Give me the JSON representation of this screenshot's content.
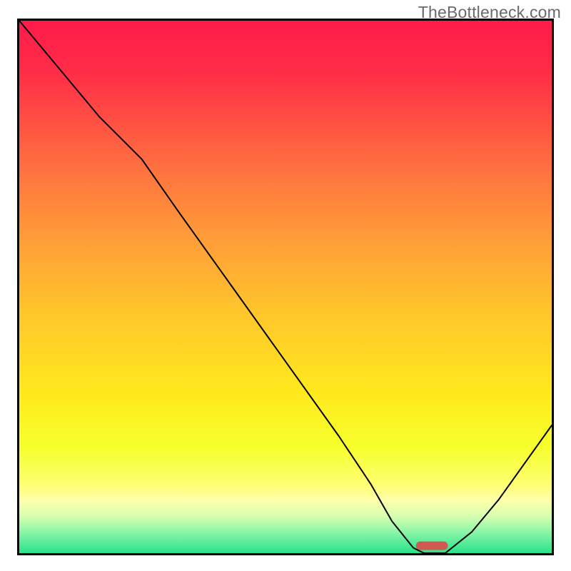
{
  "watermark": "TheBottleneck.com",
  "chart_data": {
    "type": "line",
    "title": "",
    "xlabel": "",
    "ylabel": "",
    "xlim": [
      0,
      100
    ],
    "ylim": [
      0,
      100
    ],
    "x": [
      0,
      5,
      10,
      15,
      20,
      23,
      30,
      40,
      50,
      60,
      66,
      70,
      74,
      76,
      80,
      85,
      90,
      95,
      100
    ],
    "values": [
      100,
      94,
      88,
      82,
      77,
      74,
      64,
      50,
      36,
      22,
      13,
      6,
      1,
      0,
      0,
      4,
      10,
      17,
      24
    ],
    "marker": {
      "x": 77.5,
      "width": 6,
      "y": 1.4
    },
    "gradient_stops": [
      {
        "offset": 0.0,
        "color": "#ff1a4a"
      },
      {
        "offset": 0.1,
        "color": "#ff2e47"
      },
      {
        "offset": 0.25,
        "color": "#ff6741"
      },
      {
        "offset": 0.4,
        "color": "#ff9a39"
      },
      {
        "offset": 0.55,
        "color": "#ffc62b"
      },
      {
        "offset": 0.7,
        "color": "#ffe91e"
      },
      {
        "offset": 0.8,
        "color": "#f6ff2c"
      },
      {
        "offset": 0.87,
        "color": "#ffff70"
      },
      {
        "offset": 0.9,
        "color": "#ffffaa"
      },
      {
        "offset": 0.93,
        "color": "#d8ffb0"
      },
      {
        "offset": 0.96,
        "color": "#8cf5a8"
      },
      {
        "offset": 1.0,
        "color": "#27e38a"
      }
    ]
  }
}
